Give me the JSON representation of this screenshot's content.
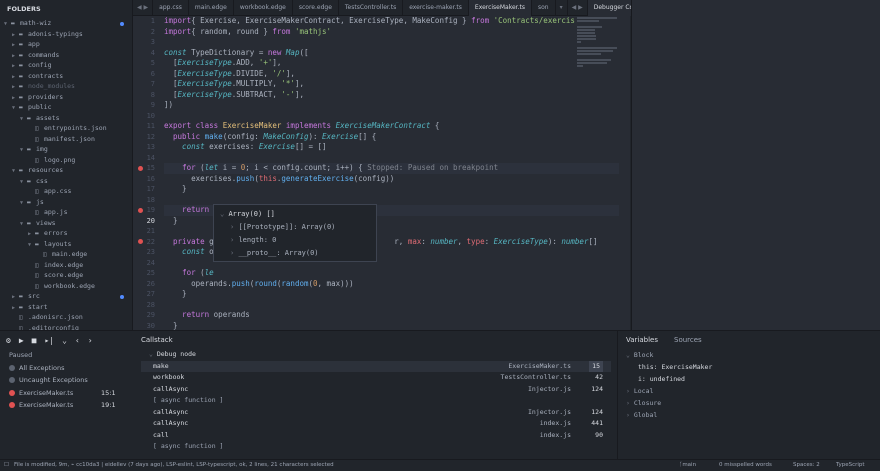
{
  "sidebar": {
    "title": "FOLDERS",
    "items": [
      {
        "label": "math-wiz",
        "depth": 0,
        "type": "dir",
        "open": true,
        "dot": true
      },
      {
        "label": "adonis-typings",
        "depth": 1,
        "type": "dir",
        "open": false
      },
      {
        "label": "app",
        "depth": 1,
        "type": "dir",
        "open": false
      },
      {
        "label": "commands",
        "depth": 1,
        "type": "dir",
        "open": false
      },
      {
        "label": "config",
        "depth": 1,
        "type": "dir",
        "open": false
      },
      {
        "label": "contracts",
        "depth": 1,
        "type": "dir",
        "open": false
      },
      {
        "label": "node_modules",
        "depth": 1,
        "type": "dir",
        "open": false,
        "dim": true
      },
      {
        "label": "providers",
        "depth": 1,
        "type": "dir",
        "open": false
      },
      {
        "label": "public",
        "depth": 1,
        "type": "dir",
        "open": true
      },
      {
        "label": "assets",
        "depth": 2,
        "type": "dir",
        "open": true
      },
      {
        "label": "entrypoints.json",
        "depth": 3,
        "type": "file"
      },
      {
        "label": "manifest.json",
        "depth": 3,
        "type": "file"
      },
      {
        "label": "img",
        "depth": 2,
        "type": "dir",
        "open": true
      },
      {
        "label": "logo.png",
        "depth": 3,
        "type": "file"
      },
      {
        "label": "resources",
        "depth": 1,
        "type": "dir",
        "open": true
      },
      {
        "label": "css",
        "depth": 2,
        "type": "dir",
        "open": true
      },
      {
        "label": "app.css",
        "depth": 3,
        "type": "file"
      },
      {
        "label": "js",
        "depth": 2,
        "type": "dir",
        "open": true
      },
      {
        "label": "app.js",
        "depth": 3,
        "type": "file"
      },
      {
        "label": "views",
        "depth": 2,
        "type": "dir",
        "open": true
      },
      {
        "label": "errors",
        "depth": 3,
        "type": "dir",
        "open": false
      },
      {
        "label": "layouts",
        "depth": 3,
        "type": "dir",
        "open": true
      },
      {
        "label": "main.edge",
        "depth": 4,
        "type": "file"
      },
      {
        "label": "index.edge",
        "depth": 3,
        "type": "file"
      },
      {
        "label": "score.edge",
        "depth": 3,
        "type": "file"
      },
      {
        "label": "workbook.edge",
        "depth": 3,
        "type": "file"
      },
      {
        "label": "src",
        "depth": 1,
        "type": "dir",
        "open": false,
        "dot": true
      },
      {
        "label": "start",
        "depth": 1,
        "type": "dir",
        "open": false
      },
      {
        "label": ".adonisrc.json",
        "depth": 1,
        "type": "file"
      },
      {
        "label": ".editorconfig",
        "depth": 1,
        "type": "file"
      }
    ]
  },
  "tabs": [
    "app.css",
    "main.edge",
    "workbook.edge",
    "score.edge",
    "TestsController.ts",
    "exercise-maker.ts",
    "ExerciseMaker.ts",
    "son"
  ],
  "active_tab": "ExerciseMaker.ts",
  "debug_console_tab": "Debugger Console",
  "editor": {
    "line_numbers": [
      "1",
      "2",
      "3",
      "4",
      "5",
      "6",
      "7",
      "8",
      "9",
      "10",
      "11",
      "12",
      "13",
      "14",
      "15",
      "16",
      "17",
      "18",
      "19",
      "20",
      "21",
      "22",
      "23",
      "24",
      "25",
      "26",
      "27",
      "28",
      "29",
      "30",
      "31"
    ],
    "current_line": "20",
    "breakpoints": [
      "15",
      "19",
      "22"
    ],
    "lines": [
      [
        [
          "kw",
          "import"
        ],
        [
          "",
          "{ Exercise, ExerciseMakerContract, ExerciseType, MakeConfig } "
        ],
        [
          "kw",
          "from"
        ],
        [
          "st",
          " 'Contracts/exercis"
        ]
      ],
      [
        [
          "kw",
          "import"
        ],
        [
          "",
          "{ random, round } "
        ],
        [
          "kw",
          "from"
        ],
        [
          "st",
          " 'mathjs'"
        ]
      ],
      [],
      [
        [
          "it",
          "const"
        ],
        [
          "",
          " TypeDictionary = "
        ],
        [
          "kw",
          "new"
        ],
        [
          "",
          " "
        ],
        [
          "tyi",
          "Map"
        ],
        [
          "",
          "(["
        ]
      ],
      [
        [
          "",
          "  ["
        ],
        [
          "tyi",
          "ExerciseType"
        ],
        [
          "",
          ".ADD, "
        ],
        [
          "st",
          "'+'"
        ],
        [
          "",
          "],"
        ]
      ],
      [
        [
          "",
          "  ["
        ],
        [
          "tyi",
          "ExerciseType"
        ],
        [
          "",
          ".DIVIDE, "
        ],
        [
          "st",
          "'/'"
        ],
        [
          "",
          "],"
        ]
      ],
      [
        [
          "",
          "  ["
        ],
        [
          "tyi",
          "ExerciseType"
        ],
        [
          "",
          ".MULTIPLY, "
        ],
        [
          "st",
          "'*'"
        ],
        [
          "",
          "],"
        ]
      ],
      [
        [
          "",
          "  ["
        ],
        [
          "tyi",
          "ExerciseType"
        ],
        [
          "",
          ".SUBTRACT, "
        ],
        [
          "st",
          "'-'"
        ],
        [
          "",
          "],"
        ]
      ],
      [
        [
          "",
          "])"
        ]
      ],
      [],
      [
        [
          "kw",
          "export class "
        ],
        [
          "ty",
          "ExerciseMaker"
        ],
        [
          "kw",
          " implements "
        ],
        [
          "tyi",
          "ExerciseMakerContract"
        ],
        [
          "",
          " {"
        ]
      ],
      [
        [
          "kw",
          "  public "
        ],
        [
          "fn",
          "make"
        ],
        [
          "",
          "(config: "
        ],
        [
          "tyi",
          "MakeConfig"
        ],
        [
          "",
          "): "
        ],
        [
          "tyi",
          "Exercise"
        ],
        [
          "",
          "[] {"
        ]
      ],
      [
        [
          "it",
          "    const"
        ],
        [
          "",
          " exercises: "
        ],
        [
          "tyi",
          "Exercise"
        ],
        [
          "",
          "[] = []"
        ]
      ],
      [],
      [
        [
          "",
          "    "
        ],
        [
          "kw",
          "for"
        ],
        [
          "",
          " ("
        ],
        [
          "it",
          "let"
        ],
        [
          "",
          " i = "
        ],
        [
          "nu",
          "0"
        ],
        [
          "",
          "; i < config.count; i++) { "
        ],
        [
          "cm",
          "Stopped: Paused on breakpoint"
        ]
      ],
      [
        [
          "",
          "      exercises."
        ],
        [
          "fn",
          "push"
        ],
        [
          "",
          "("
        ],
        [
          "pr",
          "this"
        ],
        [
          "",
          "."
        ],
        [
          "fn",
          "generateExercise"
        ],
        [
          "",
          "(config))"
        ]
      ],
      [
        [
          "",
          "    }"
        ]
      ],
      [],
      [
        [
          "kw",
          "    return"
        ],
        [
          "",
          " exercises"
        ]
      ],
      [
        [
          "",
          "  }"
        ]
      ],
      [],
      [
        [
          "kw",
          "  private"
        ],
        [
          "",
          " g                                        r, "
        ],
        [
          "pr",
          "max"
        ],
        [
          "",
          ": "
        ],
        [
          "tyi",
          "number"
        ],
        [
          "",
          ", "
        ],
        [
          "pr",
          "type"
        ],
        [
          "",
          ": "
        ],
        [
          "tyi",
          "ExerciseType"
        ],
        [
          "",
          "): "
        ],
        [
          "tyi",
          "number"
        ],
        [
          "",
          "[]"
        ]
      ],
      [
        [
          "it",
          "    const"
        ],
        [
          "",
          " o"
        ]
      ],
      [],
      [
        [
          "",
          "    "
        ],
        [
          "kw",
          "for"
        ],
        [
          "",
          " ("
        ],
        [
          "it",
          "le"
        ]
      ],
      [
        [
          "",
          "      operands."
        ],
        [
          "fn",
          "push"
        ],
        [
          "",
          "("
        ],
        [
          "fn",
          "round"
        ],
        [
          "",
          "("
        ],
        [
          "fn",
          "random"
        ],
        [
          "",
          "("
        ],
        [
          "nu",
          "0"
        ],
        [
          "",
          ", max)))"
        ]
      ],
      [
        [
          "",
          "    }"
        ]
      ],
      [],
      [
        [
          "kw",
          "    return"
        ],
        [
          "",
          " operands"
        ]
      ],
      [
        [
          "",
          "  }"
        ]
      ],
      []
    ]
  },
  "hover": {
    "title": "Array(0) []",
    "rows": [
      "[[Prototype]]: Array(0)",
      "length: 0",
      "__proto__: Array(0)"
    ]
  },
  "debug": {
    "paused_label": "Paused",
    "exceptions": [
      "All Exceptions",
      "Uncaught Exceptions"
    ],
    "breakpoints": [
      {
        "file": "ExerciseMaker.ts",
        "line": "15:1"
      },
      {
        "file": "ExerciseMaker.ts",
        "line": "19:1"
      }
    ],
    "callstack_title": "Callstack",
    "callstack_group": "Debug node",
    "frames": [
      {
        "name": "make",
        "file": "ExerciseMaker.ts",
        "line": "15",
        "selected": true
      },
      {
        "name": "workbook",
        "file": "TestsController.ts",
        "line": "42"
      },
      {
        "name": "callAsync",
        "file": "Injector.js",
        "line": "124"
      },
      {
        "name": "[ async function ]",
        "file": "",
        "line": ""
      },
      {
        "name": "callAsync",
        "file": "Injector.js",
        "line": "124"
      },
      {
        "name": "callAsync",
        "file": "index.js",
        "line": "441"
      },
      {
        "name": "call",
        "file": "index.js",
        "line": "90"
      },
      {
        "name": "[ async function ]",
        "file": "",
        "line": ""
      }
    ],
    "var_tabs": [
      "Variables",
      "Sources"
    ],
    "vars": [
      {
        "text": "Block",
        "depth": 0
      },
      {
        "text": "this: ExerciseMaker",
        "depth": 1
      },
      {
        "text": "i: undefined",
        "depth": 1
      },
      {
        "text": "Local",
        "depth": 0
      },
      {
        "text": "Closure",
        "depth": 0
      },
      {
        "text": "Global",
        "depth": 0
      }
    ]
  },
  "status": {
    "left": "File is modified, 9m,  ⌁ cc10da3 | eidellev (7 days ago), LSP-eslint, LSP-typescript, ok, 2 lines, 21 characters selected",
    "branch": "main",
    "spell": "0 misspelled words",
    "spaces": "Spaces: 2",
    "syntax": "TypeScript"
  }
}
